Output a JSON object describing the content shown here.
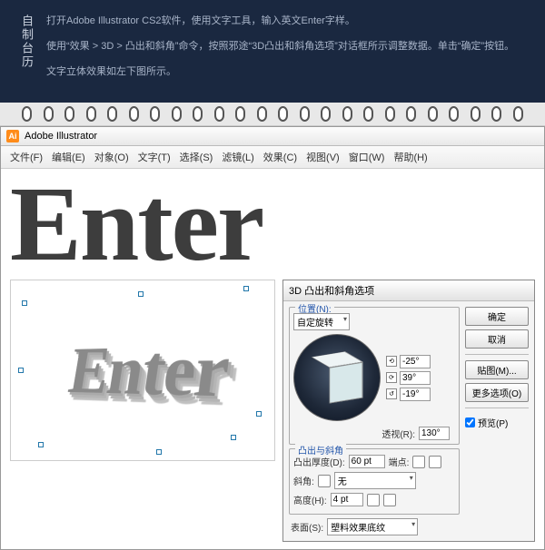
{
  "header": {
    "title": "自制台历",
    "p1": "打开Adobe Illustrator CS2软件，使用文字工具，输入英文Enter字样。",
    "p2": "使用“效果 > 3D > 凸出和斜角”命令，按照邪途“3D凸出和斜角选项”对话框所示调整数据。单击“确定”按钮。",
    "p3": "文字立体效果如左下图所示。"
  },
  "app": {
    "logo": "Ai",
    "title": "Adobe Illustrator",
    "menu": [
      "文件(F)",
      "编辑(E)",
      "对象(O)",
      "文字(T)",
      "选择(S)",
      "滤镜(L)",
      "效果(C)",
      "视图(V)",
      "窗口(W)",
      "帮助(H)"
    ]
  },
  "canvas": {
    "word": "Enter",
    "word3d": "Enter"
  },
  "dialog": {
    "title": "3D 凸出和斜角选项",
    "position_legend": "位置(N):",
    "position_value": "自定旋转",
    "rx": "-25°",
    "ry": "39°",
    "rz": "-19°",
    "perspective_label": "透视(R):",
    "perspective_value": "130°",
    "extrude_legend": "凸出与斜角",
    "depth_label": "凸出厚度(D):",
    "depth_value": "60 pt",
    "cap_label": "端点:",
    "bevel_label": "斜角:",
    "bevel_value": "无",
    "height_label": "高度(H):",
    "height_value": "4 pt",
    "surface_label": "表面(S):",
    "surface_value": "塑料效果底纹",
    "buttons": {
      "ok": "确定",
      "cancel": "取消",
      "map": "贴图(M)...",
      "more": "更多选项(O)"
    },
    "preview_label": "预览(P)"
  }
}
